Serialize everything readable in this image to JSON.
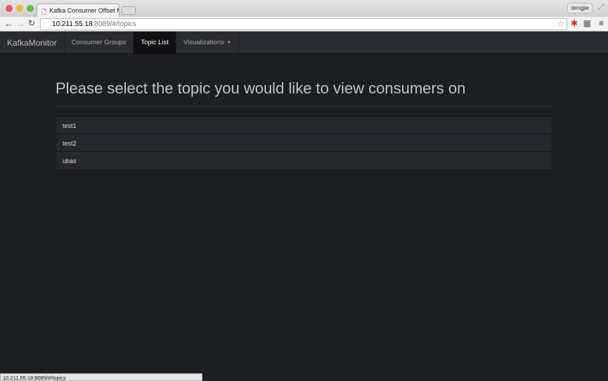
{
  "browser": {
    "tab_title": "Kafka Consumer Offset Mo",
    "tab_close": "×",
    "user": "dengjie",
    "url_host": "10.211.55.18",
    "url_path": ":8089/#/topics",
    "status_url": "10.211.55.18:8089/#/topics"
  },
  "navbar": {
    "brand": "KafkaMonitor",
    "items": [
      {
        "label": "Consumer Groups"
      },
      {
        "label": "Topic List",
        "active": true
      },
      {
        "label": "Visualizations"
      }
    ]
  },
  "main": {
    "title": "Please select the topic you would like to view consumers on",
    "topics": [
      "test1",
      "test2",
      "ubas"
    ]
  }
}
